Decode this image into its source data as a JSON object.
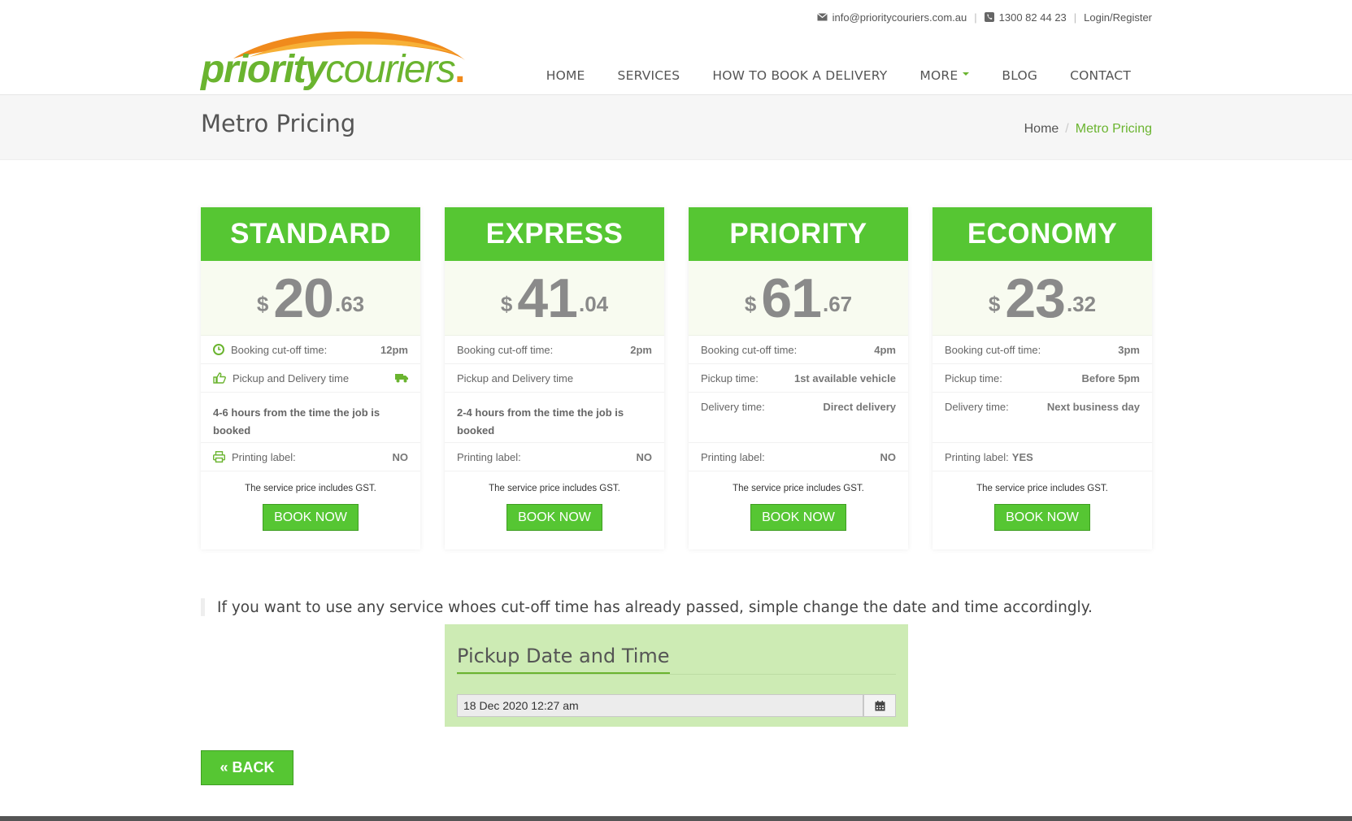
{
  "topbar": {
    "email": "info@prioritycouriers.com.au",
    "phone": "1300 82 44 23",
    "login": "Login/Register"
  },
  "logo": {
    "part1": "priority",
    "part2": "couriers",
    "dot": "."
  },
  "nav": [
    {
      "label": "HOME"
    },
    {
      "label": "SERVICES"
    },
    {
      "label": "HOW TO BOOK A DELIVERY"
    },
    {
      "label": "MORE",
      "dropdown": true
    },
    {
      "label": "BLOG"
    },
    {
      "label": "CONTACT"
    }
  ],
  "page": {
    "title": "Metro Pricing",
    "breadcrumb": {
      "home": "Home",
      "sep": "/",
      "current": "Metro Pricing"
    }
  },
  "cards": [
    {
      "name": "STANDARD",
      "currency": "$",
      "price_int": "20",
      "price_dec": ".63",
      "row1": {
        "label": "Booking cut-off time:",
        "value": "12pm"
      },
      "row2": {
        "label": "Pickup and Delivery time",
        "value": ""
      },
      "desc": "4-6 hours from the time the job is booked",
      "printing": {
        "label": "Printing label:",
        "value": "NO"
      },
      "gst": "The service price includes GST.",
      "book": "BOOK NOW"
    },
    {
      "name": "EXPRESS",
      "currency": "$",
      "price_int": "41",
      "price_dec": ".04",
      "row1": {
        "label": "Booking cut-off time:",
        "value": "2pm"
      },
      "row2": {
        "label": "Pickup and Delivery time",
        "value": ""
      },
      "desc": "2-4 hours from the time the job is booked",
      "printing": {
        "label": "Printing label:",
        "value": "NO"
      },
      "gst": "The service price includes GST.",
      "book": "BOOK NOW"
    },
    {
      "name": "PRIORITY",
      "currency": "$",
      "price_int": "61",
      "price_dec": ".67",
      "row1": {
        "label": "Booking cut-off time:",
        "value": "4pm"
      },
      "row2": {
        "label": "Pickup time:",
        "value": "1st available vehicle"
      },
      "row3": {
        "label": "Delivery time:",
        "value": "Direct delivery"
      },
      "printing": {
        "label": "Printing label:",
        "value": "NO"
      },
      "gst": "The service price includes GST.",
      "book": "BOOK NOW"
    },
    {
      "name": "ECONOMY",
      "currency": "$",
      "price_int": "23",
      "price_dec": ".32",
      "row1": {
        "label": "Booking cut-off time:",
        "value": "3pm"
      },
      "row2": {
        "label": "Pickup time:",
        "value": "Before 5pm"
      },
      "row3": {
        "label": "Delivery time:",
        "value": "Next business day"
      },
      "printing": {
        "label": "Printing label:",
        "value": "YES"
      },
      "gst": "The service price includes GST.",
      "book": "BOOK NOW"
    }
  ],
  "notice": "If you want to use any service whoes cut-off time has already passed, simple change the date and time accordingly.",
  "pickup": {
    "title": "Pickup Date and Time",
    "value": "18 Dec 2020 12:27 am"
  },
  "back": "« BACK",
  "colors": {
    "brand_green": "#56c633",
    "logo_green": "#6ab42f",
    "logo_orange": "#f08a1c",
    "panel_green": "#cdebb4"
  }
}
